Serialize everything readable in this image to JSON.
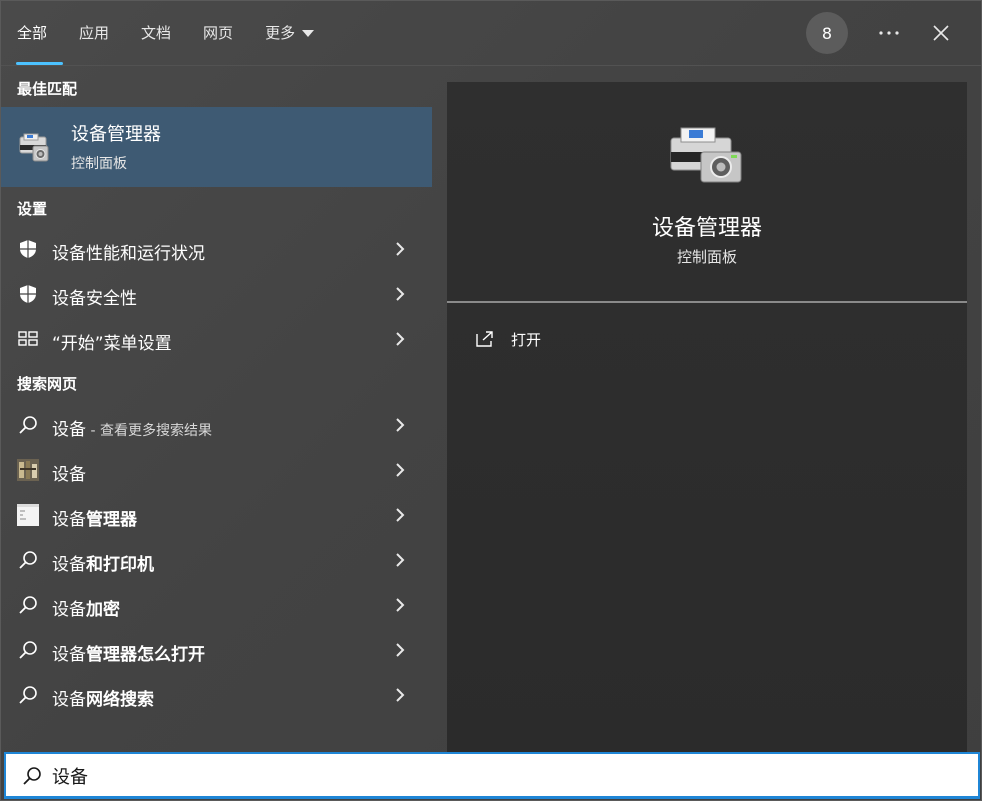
{
  "tabs": [
    {
      "label": "全部"
    },
    {
      "label": "应用"
    },
    {
      "label": "文档"
    },
    {
      "label": "网页"
    },
    {
      "label": "更多"
    }
  ],
  "header": {
    "avatar_text": "8",
    "more_icon": "more-horizontal-icon",
    "close_icon": "close-icon"
  },
  "best_match": {
    "header": "最佳匹配",
    "title": "设备管理器",
    "subtitle": "控制面板",
    "icon": "device-manager-icon"
  },
  "settings": {
    "header": "设置",
    "items": [
      {
        "label": "设备性能和运行状况",
        "icon": "shield-icon"
      },
      {
        "label": "设备安全性",
        "icon": "shield-icon"
      },
      {
        "label": "“开始”菜单设置",
        "icon": "start-menu-icon"
      }
    ]
  },
  "web": {
    "header": "搜索网页",
    "items": [
      {
        "prefix": "设备",
        "bold": "",
        "suffix": " - 查看更多搜索结果",
        "icon": "search-icon"
      },
      {
        "prefix": "设备",
        "bold": "",
        "suffix": "",
        "icon": "thumbnail-icon"
      },
      {
        "prefix": "设备",
        "bold": "管理器",
        "suffix": "",
        "icon": "thumbnail-icon"
      },
      {
        "prefix": "设备",
        "bold": "和打印机",
        "suffix": "",
        "icon": "search-icon"
      },
      {
        "prefix": "设备",
        "bold": "加密",
        "suffix": "",
        "icon": "search-icon"
      },
      {
        "prefix": "设备",
        "bold": "管理器怎么打开",
        "suffix": "",
        "icon": "search-icon"
      },
      {
        "prefix": "设备",
        "bold": "网络搜索",
        "suffix": "",
        "icon": "search-icon"
      }
    ]
  },
  "preview": {
    "title": "设备管理器",
    "subtitle": "控制面板",
    "action_label": "打开",
    "action_icon": "open-external-icon"
  },
  "search": {
    "value": "设备",
    "icon": "search-icon"
  },
  "colors": {
    "accent": "#4cc2ff",
    "selected_bg": "#3e5a73",
    "search_border": "#1f86d6"
  }
}
